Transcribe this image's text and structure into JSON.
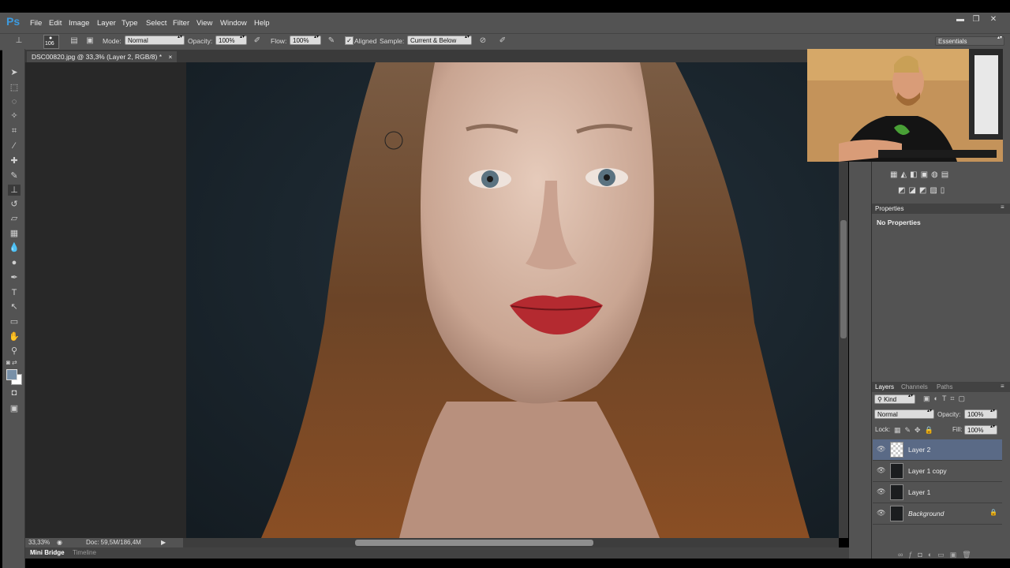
{
  "app": {
    "logo": "Ps"
  },
  "menu": [
    "File",
    "Edit",
    "Image",
    "Layer",
    "Type",
    "Select",
    "Filter",
    "View",
    "Window",
    "Help"
  ],
  "window_controls": {
    "minimize": "▬",
    "restore": "❐",
    "close": "✕"
  },
  "options_bar": {
    "brush_size": "106",
    "mode_label": "Mode:",
    "mode_value": "Normal",
    "opacity_label": "Opacity:",
    "opacity_value": "100%",
    "flow_label": "Flow:",
    "flow_value": "100%",
    "aligned_label": "Aligned",
    "sample_label": "Sample:",
    "sample_value": "Current & Below",
    "workspace": "Essentials"
  },
  "document_tab": {
    "title": "DSC00820.jpg @ 33,3% (Layer 2, RGB/8) *",
    "close": "×"
  },
  "status": {
    "zoom": "33,33%",
    "doc": "Doc: 59,5M/186,4M"
  },
  "bottom_tabs": [
    "Mini Bridge",
    "Timeline"
  ],
  "properties": {
    "tab": "Properties",
    "content": "No Properties"
  },
  "layers_panel": {
    "tabs": [
      "Layers",
      "Channels",
      "Paths"
    ],
    "filter": "Kind",
    "blend_mode": "Normal",
    "opacity_label": "Opacity:",
    "opacity_value": "100%",
    "lock_label": "Lock:",
    "fill_label": "Fill:",
    "fill_value": "100%",
    "layers": [
      {
        "name": "Layer 2",
        "selected": true
      },
      {
        "name": "Layer 1 copy",
        "selected": false
      },
      {
        "name": "Layer 1",
        "selected": false
      },
      {
        "name": "Background",
        "selected": false
      }
    ]
  },
  "colors": {
    "accent": "#3c9be0",
    "selected_layer": "#5a6a86",
    "ui_gray": "#535353"
  }
}
